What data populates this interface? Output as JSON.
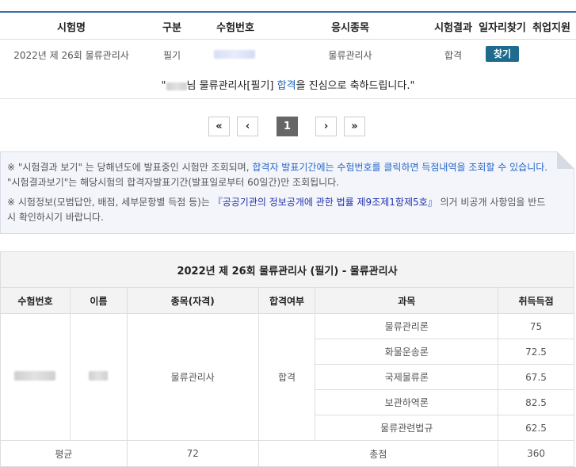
{
  "results_header": {
    "col_exam_name": "시험명",
    "col_type": "구분",
    "col_exam_number": "수험번호",
    "col_category": "응시종목",
    "col_result": "시험결과",
    "col_job_search": "일자리찾기",
    "col_employment": "취업지원"
  },
  "results_row": {
    "exam_name": "2022년 제 26회 물류관리사",
    "type": "필기",
    "category": "물류관리사",
    "result": "합격",
    "find_button": "찾기"
  },
  "congrats": {
    "prefix": "\"",
    "mid": "님 물류관리사[필기] ",
    "highlight": "합격",
    "suffix": "을 진심으로 축하드립니다.\""
  },
  "pagination": {
    "first": "«",
    "prev": "‹",
    "current": "1",
    "next": "›",
    "last": "»"
  },
  "notice": {
    "line1_a": "※ \"시험결과 보기\" 는 당해년도에 발표중인 시험만 조회되며, ",
    "line1_blue": "합격자 발표기간에는 수험번호를 클릭하면 득점내역을 조회할 수 있습니다.",
    "line1_b": " \"시험결과보기\"는 해당시험의 합격자발표기간(발표일로부터 60일간)만 조회됩니다.",
    "line2_a": "※ 시험정보(모범답안, 배점, 세부문항별 득점 등)는 ",
    "line2_link": "『공공기관의 정보공개에 관한 법률 제9조제1항제5호』",
    "line2_b": " 의거 비공개 사항임을 반드시 확인하시기 바랍니다."
  },
  "score_table": {
    "title": "2022년 제 26회 물류관리사 (필기) - 물류관리사",
    "col_exam_number": "수험번호",
    "col_name": "이름",
    "col_category": "종목(자격)",
    "col_pass": "합격여부",
    "col_subject": "과목",
    "col_score": "취득득점",
    "category": "물류관리사",
    "pass": "합격",
    "subjects": [
      {
        "name": "물류관리론",
        "score": "75"
      },
      {
        "name": "화물운송론",
        "score": "72.5"
      },
      {
        "name": "국제물류론",
        "score": "67.5"
      },
      {
        "name": "보관하역론",
        "score": "82.5"
      },
      {
        "name": "물류관련법규",
        "score": "62.5"
      }
    ],
    "avg_label": "평균",
    "avg_value": "72",
    "total_label": "총점",
    "total_value": "360"
  }
}
